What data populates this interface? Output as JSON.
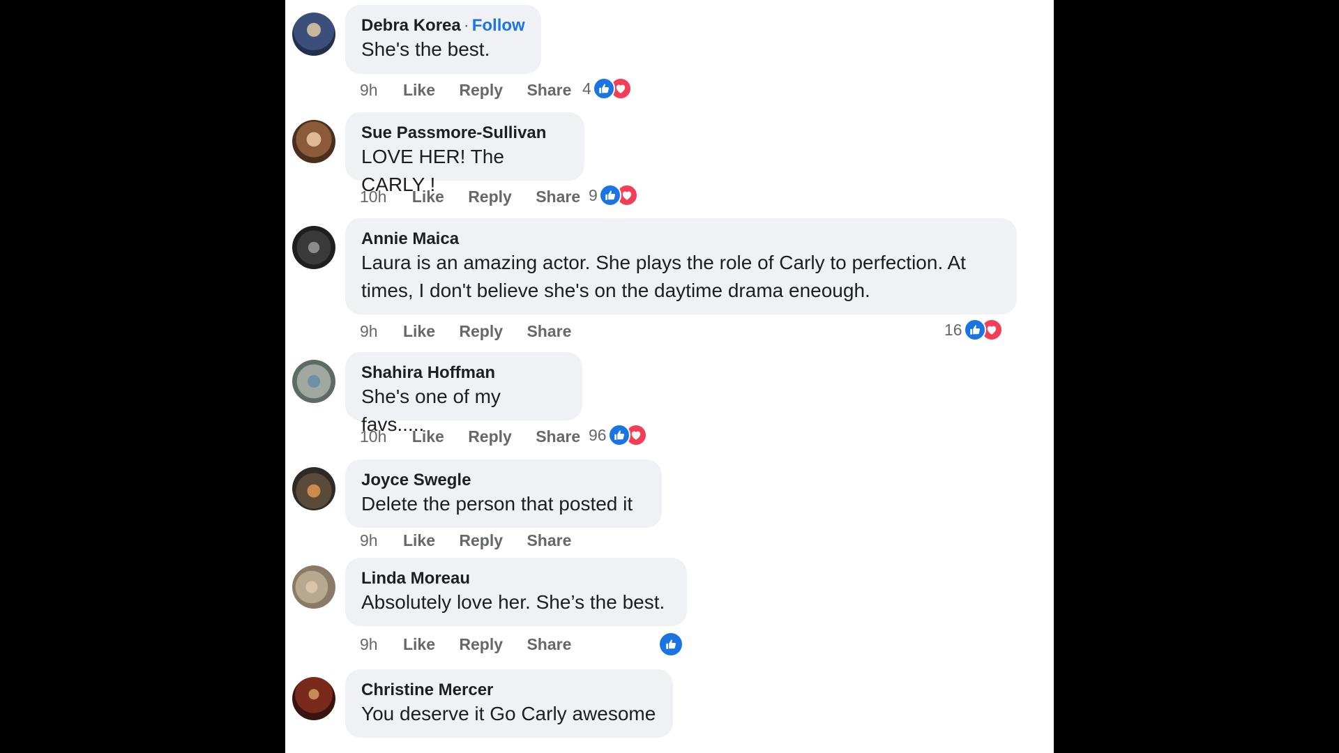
{
  "colors": {
    "page_background": "#000000",
    "panel_background": "#ffffff",
    "bubble_background": "#eff1f4",
    "link_blue": "#1b74e4",
    "like_blue": "#1b74e4",
    "love_red": "#f33e58",
    "meta_gray": "#65676b"
  },
  "actions": {
    "like": "Like",
    "reply": "Reply",
    "share": "Share"
  },
  "comments": [
    {
      "author": "Debra Korea",
      "follow": "Follow",
      "text": "She's the best.",
      "time": "9h",
      "reaction_count": "4",
      "reactions": [
        "like-icon",
        "love-icon"
      ]
    },
    {
      "author": "Sue Passmore-Sullivan",
      "text": "LOVE HER! The CARLY !",
      "time": "10h",
      "reaction_count": "9",
      "reactions": [
        "like-icon",
        "love-icon"
      ]
    },
    {
      "author": "Annie Maica",
      "text": "Laura is an amazing actor. She plays the role of Carly to perfection. At times, I don't believe she's on the daytime drama eneough.",
      "time": "9h",
      "reaction_count": "16",
      "reactions": [
        "like-icon",
        "love-icon"
      ]
    },
    {
      "author": "Shahira Hoffman",
      "text": "She's one of my favs.....",
      "time": "10h",
      "reaction_count": "96",
      "reactions": [
        "like-icon",
        "love-icon"
      ]
    },
    {
      "author": "Joyce Swegle",
      "text": "Delete the person that posted it",
      "time": "9h"
    },
    {
      "author": "Linda Moreau",
      "text": "Absolutely love her. She’s the best.",
      "time": "9h",
      "reactions": [
        "like-icon"
      ]
    },
    {
      "author": "Christine Mercer",
      "text": "You deserve it Go Carly awesome"
    }
  ]
}
